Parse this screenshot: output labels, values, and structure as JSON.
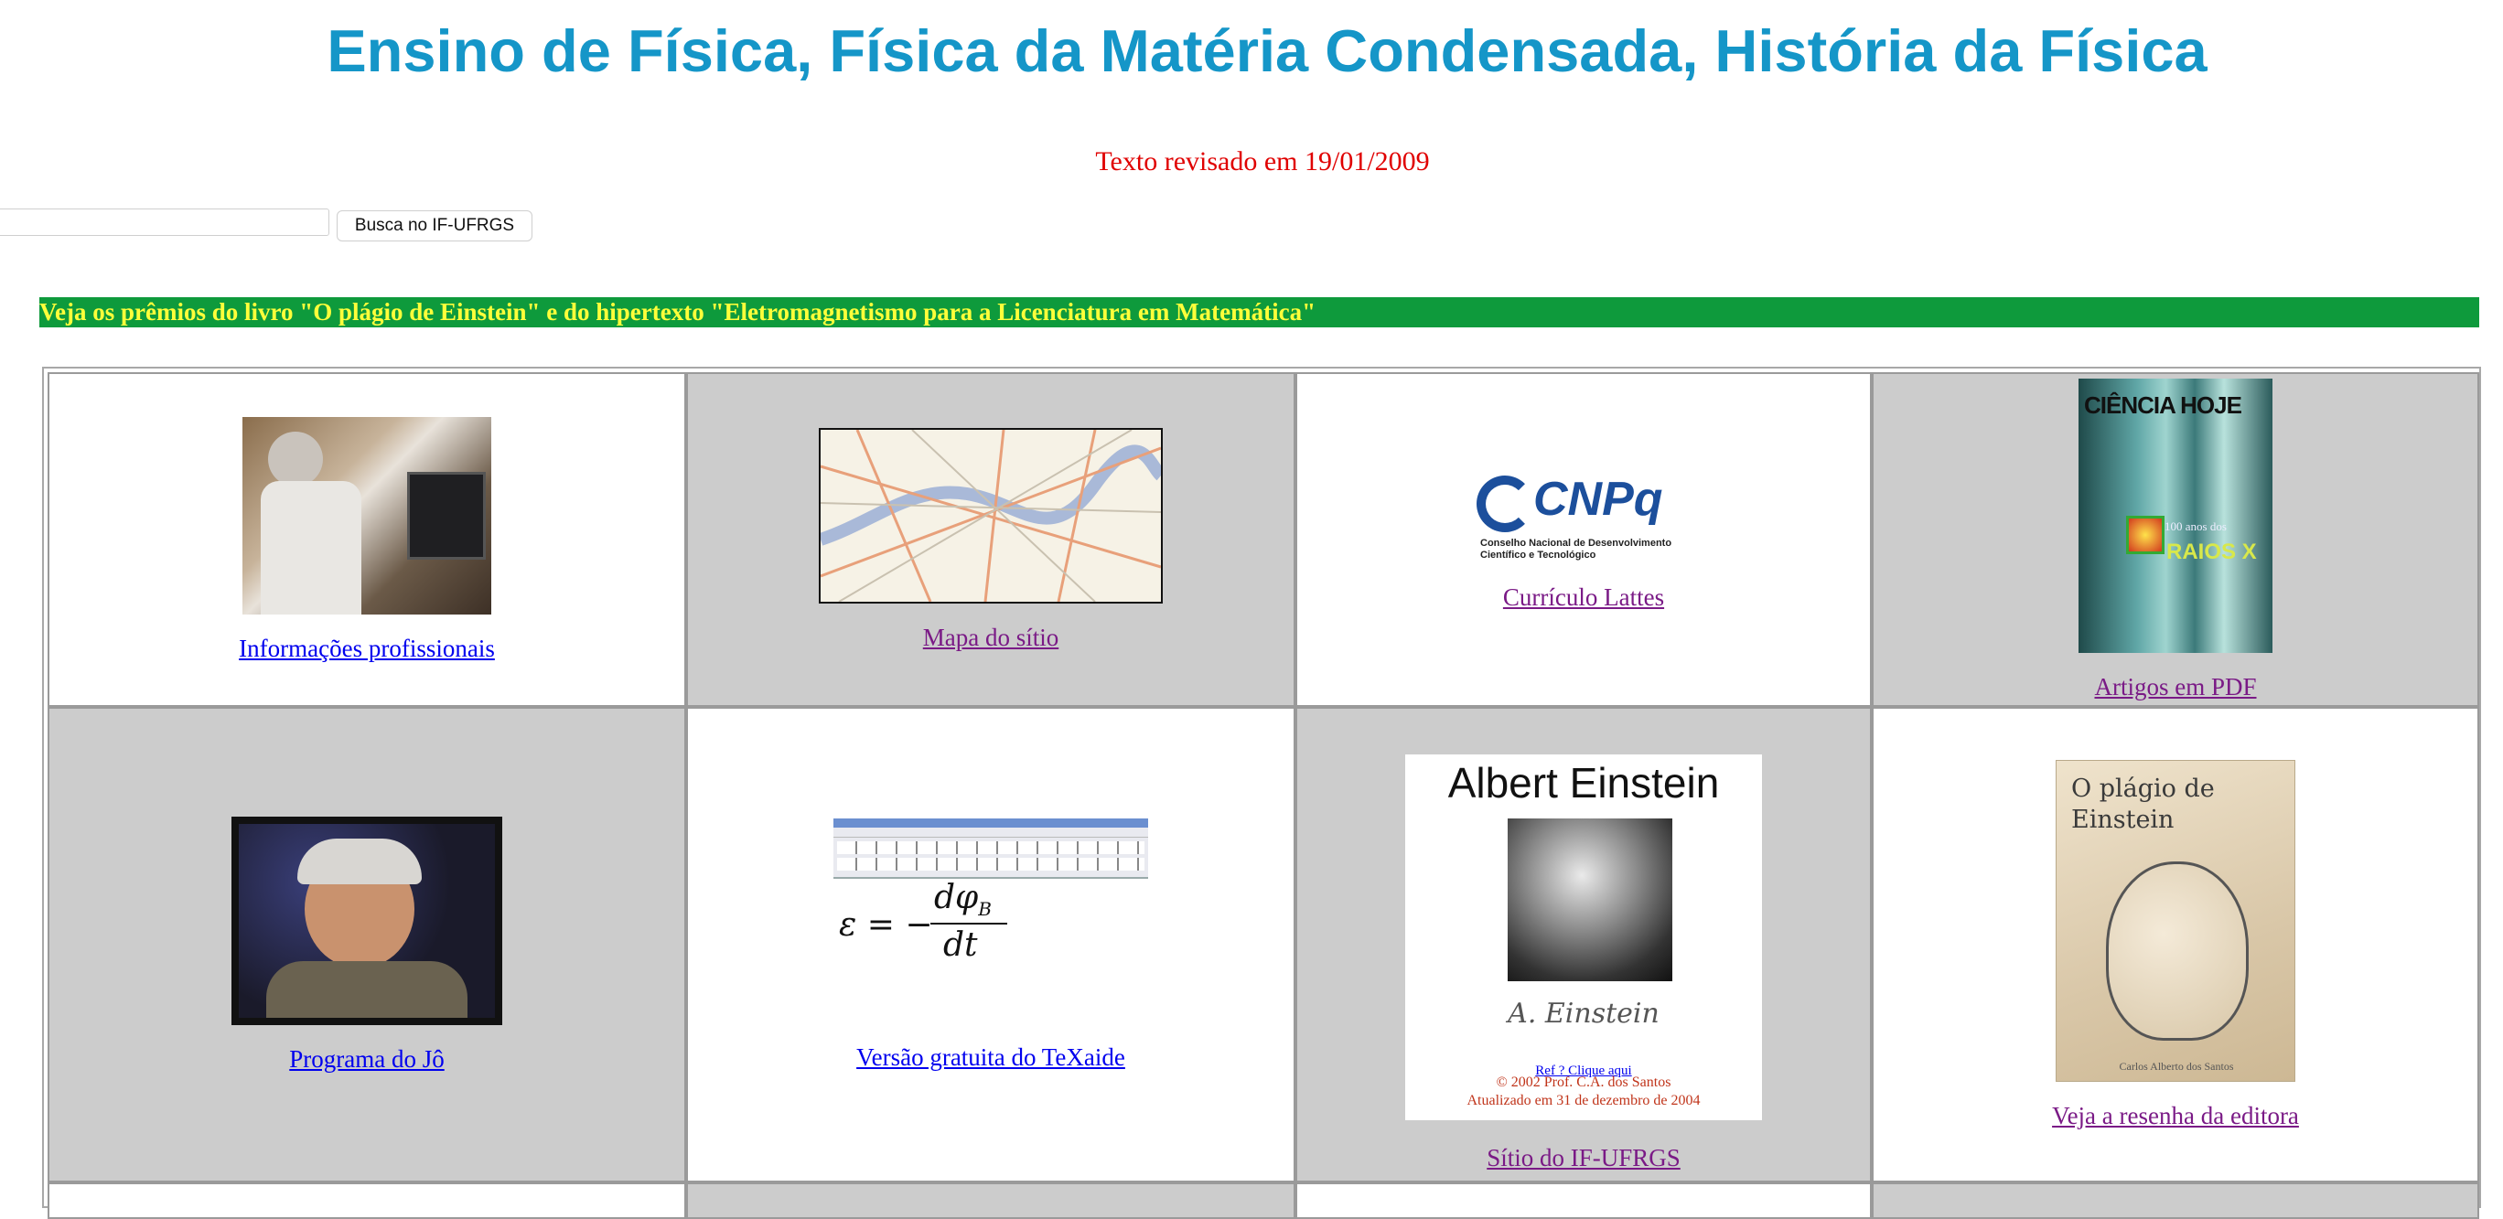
{
  "page": {
    "title": "Ensino de Física, Física da Matéria Condensada, História da Física",
    "revised": "Texto revisado em 19/01/2009"
  },
  "search": {
    "value": "",
    "button_label": "Busca no IF-UFRGS"
  },
  "banner": {
    "text": "Veja os prêmios do livro \"O plágio de Einstein\" e do hipertexto \"Eletromagnetismo para a Licenciatura em Matemática\""
  },
  "cells": {
    "info": "Informações profissionais",
    "mapa": "Mapa do sítio",
    "lattes": "Currículo Lattes",
    "pdf": "Artigos em PDF",
    "jo": "Programa do Jô",
    "texaide": "Versão gratuita do TeXaide",
    "ifufrgs": "Sítio do IF-UFRGS",
    "resenha": "Veja a resenha da editora"
  },
  "logos": {
    "cnpq_name": "CNPq",
    "cnpq_sub": "Conselho Nacional de Desenvolvimento Científico e Tecnológico",
    "ciencia_hoje": "CIÊNCIA HOJE",
    "raios_x_small": "100 anos dos",
    "raios_x": "RAIOS X",
    "plagio_cover": "O plágio de Einstein",
    "cover_author": "Carlos Alberto dos Santos"
  },
  "einstein_card": {
    "name": "Albert Einstein",
    "signature": "A. Einstein",
    "ref": "Ref ? Clique aqui",
    "copyright": "© 2002 Prof. C.A. dos Santos",
    "updated": "Atualizado em 31 de dezembro de 2004"
  },
  "equation": {
    "lhs": "ε = −",
    "num": "dφ",
    "sub": "B",
    "den": "dt"
  },
  "colors": {
    "title": "#1596c8",
    "revised": "#e00000",
    "banner_bg": "#0e9a3c",
    "banner_text": "#ffff3a",
    "link": "#0000ee",
    "visited": "#7a1a86",
    "cell_gray": "#cccccc"
  }
}
